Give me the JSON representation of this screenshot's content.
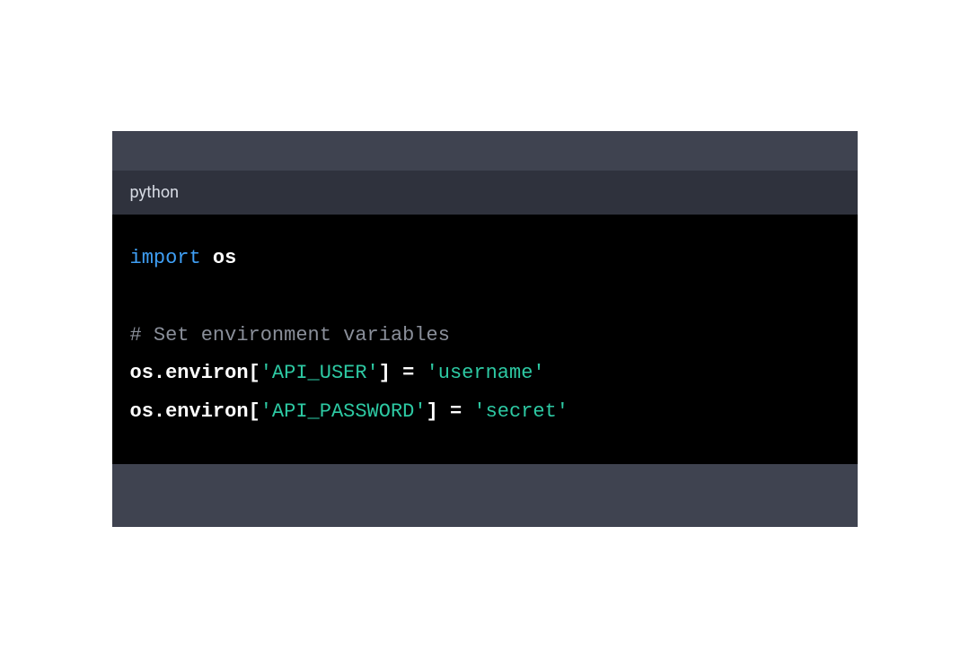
{
  "language_label": "python",
  "code": {
    "line1": {
      "import": "import",
      "module": "os"
    },
    "line2": "",
    "line3": {
      "comment": "# Set environment variables"
    },
    "line4": {
      "obj": "os",
      "dot1": ".",
      "attr": "environ",
      "lbr": "[",
      "key": "'API_USER'",
      "rbr": "]",
      "eq": " = ",
      "val": "'username'"
    },
    "line5": {
      "obj": "os",
      "dot1": ".",
      "attr": "environ",
      "lbr": "[",
      "key": "'API_PASSWORD'",
      "rbr": "]",
      "eq": " = ",
      "val": "'secret'"
    }
  }
}
